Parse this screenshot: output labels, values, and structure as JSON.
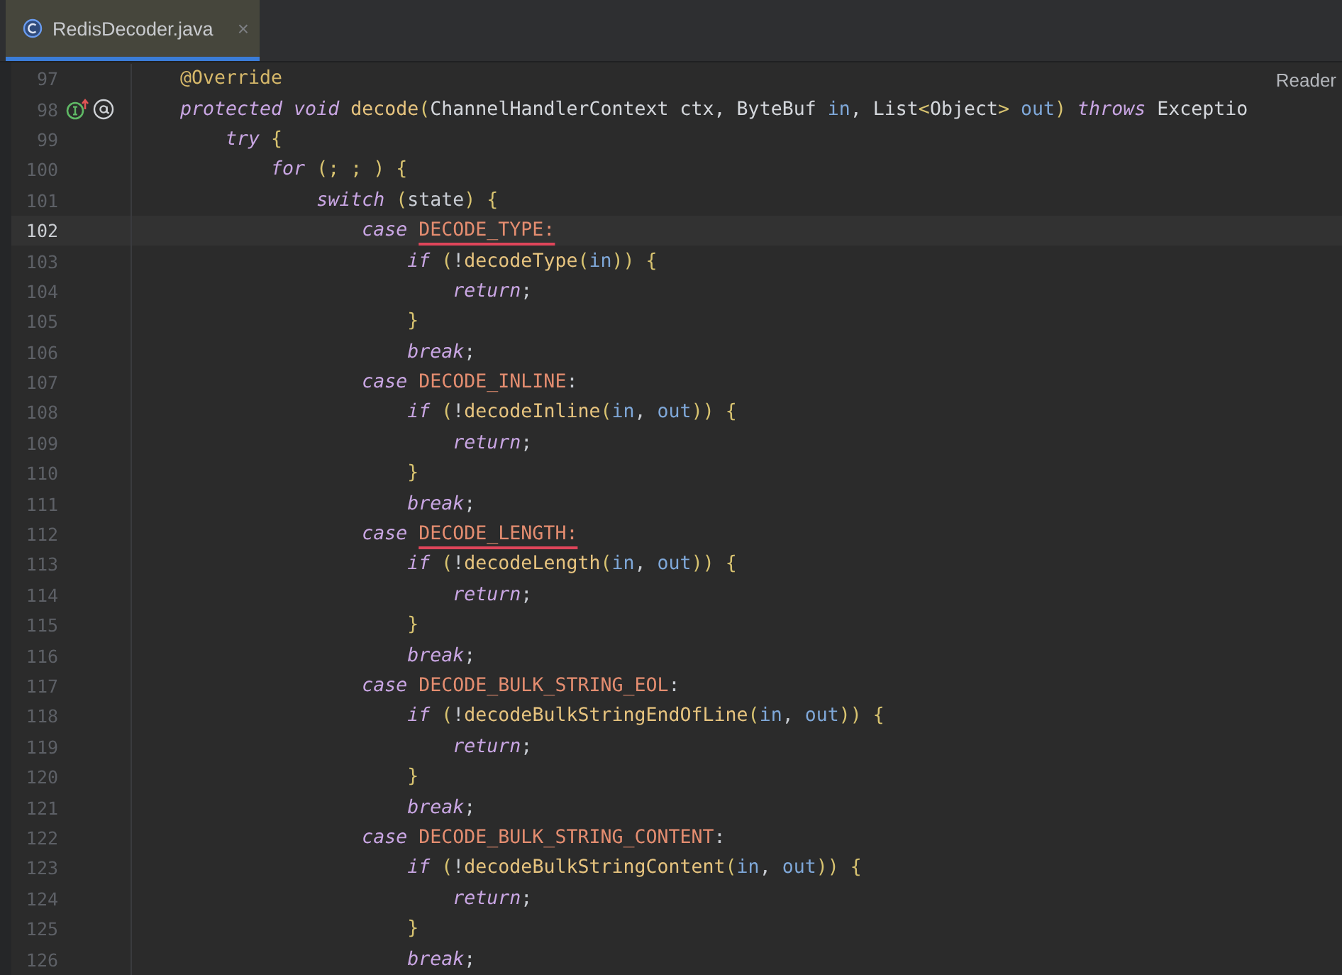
{
  "tab": {
    "title": "RedisDecoder.java",
    "close": "×",
    "selected": true
  },
  "reader_label": "Reader",
  "lines": [
    {
      "number": "97",
      "current": false,
      "markers": false,
      "tokens": [
        {
          "kind": "annotation",
          "text": "@Override"
        }
      ]
    },
    {
      "number": "98",
      "current": false,
      "markers": true,
      "tokens": [
        {
          "kind": "keyword",
          "text": "protected void "
        },
        {
          "kind": "method",
          "text": "decode"
        },
        {
          "kind": "punct",
          "text": "("
        },
        {
          "kind": "type",
          "text": "ChannelHandlerContext ctx, ByteBuf "
        },
        {
          "kind": "param",
          "text": "in"
        },
        {
          "kind": "type",
          "text": ", List"
        },
        {
          "kind": "punct",
          "text": "<"
        },
        {
          "kind": "type",
          "text": "Object"
        },
        {
          "kind": "punct",
          "text": ">"
        },
        {
          "kind": "param",
          "text": " out"
        },
        {
          "kind": "punct",
          "text": ")"
        },
        {
          "kind": "keyword",
          "text": " throws "
        },
        {
          "kind": "type",
          "text": "Exceptio"
        }
      ]
    },
    {
      "number": "99",
      "current": false,
      "markers": false,
      "tokens": [
        {
          "kind": "keyword",
          "text": "    try"
        },
        {
          "kind": "punct",
          "text": " {"
        }
      ]
    },
    {
      "number": "100",
      "current": false,
      "markers": false,
      "tokens": [
        {
          "kind": "keyword",
          "text": "        for"
        },
        {
          "kind": "punct",
          "text": " (; ; ) {"
        }
      ]
    },
    {
      "number": "101",
      "current": false,
      "markers": false,
      "tokens": [
        {
          "kind": "keyword",
          "text": "            switch"
        },
        {
          "kind": "punct",
          "text": " ("
        },
        {
          "kind": "plain",
          "text": "state"
        },
        {
          "kind": "punct",
          "text": ") {"
        }
      ]
    },
    {
      "number": "102",
      "current": true,
      "markers": false,
      "tokens": [
        {
          "kind": "keyword",
          "text": "                case "
        },
        {
          "kind": "constant",
          "text": "DECODE_TYPE:",
          "underlined": true
        }
      ]
    },
    {
      "number": "103",
      "current": false,
      "markers": false,
      "tokens": [
        {
          "kind": "keyword",
          "text": "                    if"
        },
        {
          "kind": "punct",
          "text": " ("
        },
        {
          "kind": "plain",
          "text": "!"
        },
        {
          "kind": "method",
          "text": "decodeType"
        },
        {
          "kind": "punct",
          "text": "("
        },
        {
          "kind": "param",
          "text": "in"
        },
        {
          "kind": "punct",
          "text": ")) {"
        }
      ]
    },
    {
      "number": "104",
      "current": false,
      "markers": false,
      "tokens": [
        {
          "kind": "keyword",
          "text": "                        return"
        },
        {
          "kind": "plain",
          "text": ";"
        }
      ]
    },
    {
      "number": "105",
      "current": false,
      "markers": false,
      "tokens": [
        {
          "kind": "punct",
          "text": "                    }"
        }
      ]
    },
    {
      "number": "106",
      "current": false,
      "markers": false,
      "tokens": [
        {
          "kind": "keyword",
          "text": "                    break"
        },
        {
          "kind": "plain",
          "text": ";"
        }
      ]
    },
    {
      "number": "107",
      "current": false,
      "markers": false,
      "tokens": [
        {
          "kind": "keyword",
          "text": "                case "
        },
        {
          "kind": "constant",
          "text": "DECODE_INLINE"
        },
        {
          "kind": "plain",
          "text": ":"
        }
      ]
    },
    {
      "number": "108",
      "current": false,
      "markers": false,
      "tokens": [
        {
          "kind": "keyword",
          "text": "                    if"
        },
        {
          "kind": "punct",
          "text": " ("
        },
        {
          "kind": "plain",
          "text": "!"
        },
        {
          "kind": "method",
          "text": "decodeInline"
        },
        {
          "kind": "punct",
          "text": "("
        },
        {
          "kind": "param",
          "text": "in"
        },
        {
          "kind": "plain",
          "text": ", "
        },
        {
          "kind": "param",
          "text": "out"
        },
        {
          "kind": "punct",
          "text": ")) {"
        }
      ]
    },
    {
      "number": "109",
      "current": false,
      "markers": false,
      "tokens": [
        {
          "kind": "keyword",
          "text": "                        return"
        },
        {
          "kind": "plain",
          "text": ";"
        }
      ]
    },
    {
      "number": "110",
      "current": false,
      "markers": false,
      "tokens": [
        {
          "kind": "punct",
          "text": "                    }"
        }
      ]
    },
    {
      "number": "111",
      "current": false,
      "markers": false,
      "tokens": [
        {
          "kind": "keyword",
          "text": "                    break"
        },
        {
          "kind": "plain",
          "text": ";"
        }
      ]
    },
    {
      "number": "112",
      "current": false,
      "markers": false,
      "tokens": [
        {
          "kind": "keyword",
          "text": "                case "
        },
        {
          "kind": "constant",
          "text": "DECODE_LENGTH:",
          "underlined": true
        }
      ]
    },
    {
      "number": "113",
      "current": false,
      "markers": false,
      "tokens": [
        {
          "kind": "keyword",
          "text": "                    if"
        },
        {
          "kind": "punct",
          "text": " ("
        },
        {
          "kind": "plain",
          "text": "!"
        },
        {
          "kind": "method",
          "text": "decodeLength"
        },
        {
          "kind": "punct",
          "text": "("
        },
        {
          "kind": "param",
          "text": "in"
        },
        {
          "kind": "plain",
          "text": ", "
        },
        {
          "kind": "param",
          "text": "out"
        },
        {
          "kind": "punct",
          "text": ")) {"
        }
      ]
    },
    {
      "number": "114",
      "current": false,
      "markers": false,
      "tokens": [
        {
          "kind": "keyword",
          "text": "                        return"
        },
        {
          "kind": "plain",
          "text": ";"
        }
      ]
    },
    {
      "number": "115",
      "current": false,
      "markers": false,
      "tokens": [
        {
          "kind": "punct",
          "text": "                    }"
        }
      ]
    },
    {
      "number": "116",
      "current": false,
      "markers": false,
      "tokens": [
        {
          "kind": "keyword",
          "text": "                    break"
        },
        {
          "kind": "plain",
          "text": ";"
        }
      ]
    },
    {
      "number": "117",
      "current": false,
      "markers": false,
      "tokens": [
        {
          "kind": "keyword",
          "text": "                case "
        },
        {
          "kind": "constant",
          "text": "DECODE_BULK_STRING_EOL"
        },
        {
          "kind": "plain",
          "text": ":"
        }
      ]
    },
    {
      "number": "118",
      "current": false,
      "markers": false,
      "tokens": [
        {
          "kind": "keyword",
          "text": "                    if"
        },
        {
          "kind": "punct",
          "text": " ("
        },
        {
          "kind": "plain",
          "text": "!"
        },
        {
          "kind": "method",
          "text": "decodeBulkStringEndOfLine"
        },
        {
          "kind": "punct",
          "text": "("
        },
        {
          "kind": "param",
          "text": "in"
        },
        {
          "kind": "plain",
          "text": ", "
        },
        {
          "kind": "param",
          "text": "out"
        },
        {
          "kind": "punct",
          "text": ")) {"
        }
      ]
    },
    {
      "number": "119",
      "current": false,
      "markers": false,
      "tokens": [
        {
          "kind": "keyword",
          "text": "                        return"
        },
        {
          "kind": "plain",
          "text": ";"
        }
      ]
    },
    {
      "number": "120",
      "current": false,
      "markers": false,
      "tokens": [
        {
          "kind": "punct",
          "text": "                    }"
        }
      ]
    },
    {
      "number": "121",
      "current": false,
      "markers": false,
      "tokens": [
        {
          "kind": "keyword",
          "text": "                    break"
        },
        {
          "kind": "plain",
          "text": ";"
        }
      ]
    },
    {
      "number": "122",
      "current": false,
      "markers": false,
      "tokens": [
        {
          "kind": "keyword",
          "text": "                case "
        },
        {
          "kind": "constant",
          "text": "DECODE_BULK_STRING_CONTENT"
        },
        {
          "kind": "plain",
          "text": ":"
        }
      ]
    },
    {
      "number": "123",
      "current": false,
      "markers": false,
      "tokens": [
        {
          "kind": "keyword",
          "text": "                    if"
        },
        {
          "kind": "punct",
          "text": " ("
        },
        {
          "kind": "plain",
          "text": "!"
        },
        {
          "kind": "method",
          "text": "decodeBulkStringContent"
        },
        {
          "kind": "punct",
          "text": "("
        },
        {
          "kind": "param",
          "text": "in"
        },
        {
          "kind": "plain",
          "text": ", "
        },
        {
          "kind": "param",
          "text": "out"
        },
        {
          "kind": "punct",
          "text": ")) {"
        }
      ]
    },
    {
      "number": "124",
      "current": false,
      "markers": false,
      "tokens": [
        {
          "kind": "keyword",
          "text": "                        return"
        },
        {
          "kind": "plain",
          "text": ";"
        }
      ]
    },
    {
      "number": "125",
      "current": false,
      "markers": false,
      "tokens": [
        {
          "kind": "punct",
          "text": "                    }"
        }
      ]
    },
    {
      "number": "126",
      "current": false,
      "markers": false,
      "tokens": [
        {
          "kind": "keyword",
          "text": "                    break"
        },
        {
          "kind": "plain",
          "text": ";"
        }
      ]
    }
  ]
}
